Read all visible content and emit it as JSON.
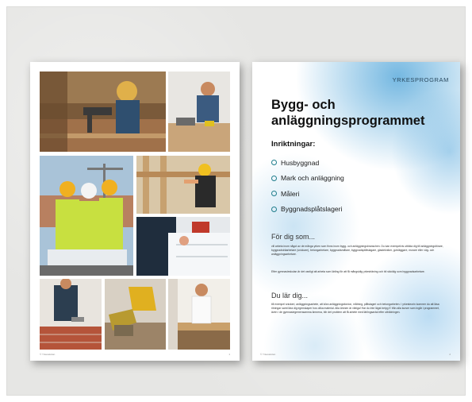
{
  "left_page": {
    "footer_left": "© Yrkesskolan",
    "page_number": "1",
    "photos": [
      {
        "name": "carpenter-drilling-photo"
      },
      {
        "name": "worker-sawing-photo"
      },
      {
        "name": "team-with-blueprints-photo"
      },
      {
        "name": "timber-frame-worker-photo"
      },
      {
        "name": "blueprint-hands-photo"
      },
      {
        "name": "bricklayer-photo"
      },
      {
        "name": "excavator-photo"
      },
      {
        "name": "workshop-worker-photo"
      }
    ]
  },
  "right_page": {
    "eyebrow": "YRKESPROGRAM",
    "title_line1": "Bygg- och",
    "title_line2": "anläggningsprogrammet",
    "tracks_heading": "Inriktningar:",
    "tracks": [
      "Husbyggnad",
      "Mark och anläggning",
      "Måleri",
      "Byggnadsplåtslageri"
    ],
    "section1_heading": "För dig som...",
    "section1_p1": "vill arbeta inom något av de många yrken som finns inom bygg- och anläggningsbranschen. Du kan exempelvis utbilda dig till anläggningsförare, byggnadsträarbetare (snickare), betongarbetare, byggnadsmålare, byggnadsplåtslagare, glastekniker, golvläggare, murare eller väg- och anläggningsarbetare.",
    "section1_p2": "Efter gymnasieskolan är det vanligt att arbeta som lärling för att få mångsidig yrkesträning och bli skicklig som byggnadsarbetare.",
    "section2_heading": "Du lär dig...",
    "section2_p1": "till exempel snickeri, anläggningsarbete, att köra anläggningsfordon, målning, plåtslageri och betongarbeten. I yrkesteorin kommer du att läsa ritningar samt lära dig egenskaper hos olika material. Alla ämnen är viktiga! Har du inte lägst betyg E från alla kurser som ingår i programmet, även i de gymnasiegemensamma ämnena, blir det problem att få arbete med lärlingsavtal efter utbildningen.",
    "footer_left": "© Yrkesskolan",
    "page_number": "2"
  }
}
